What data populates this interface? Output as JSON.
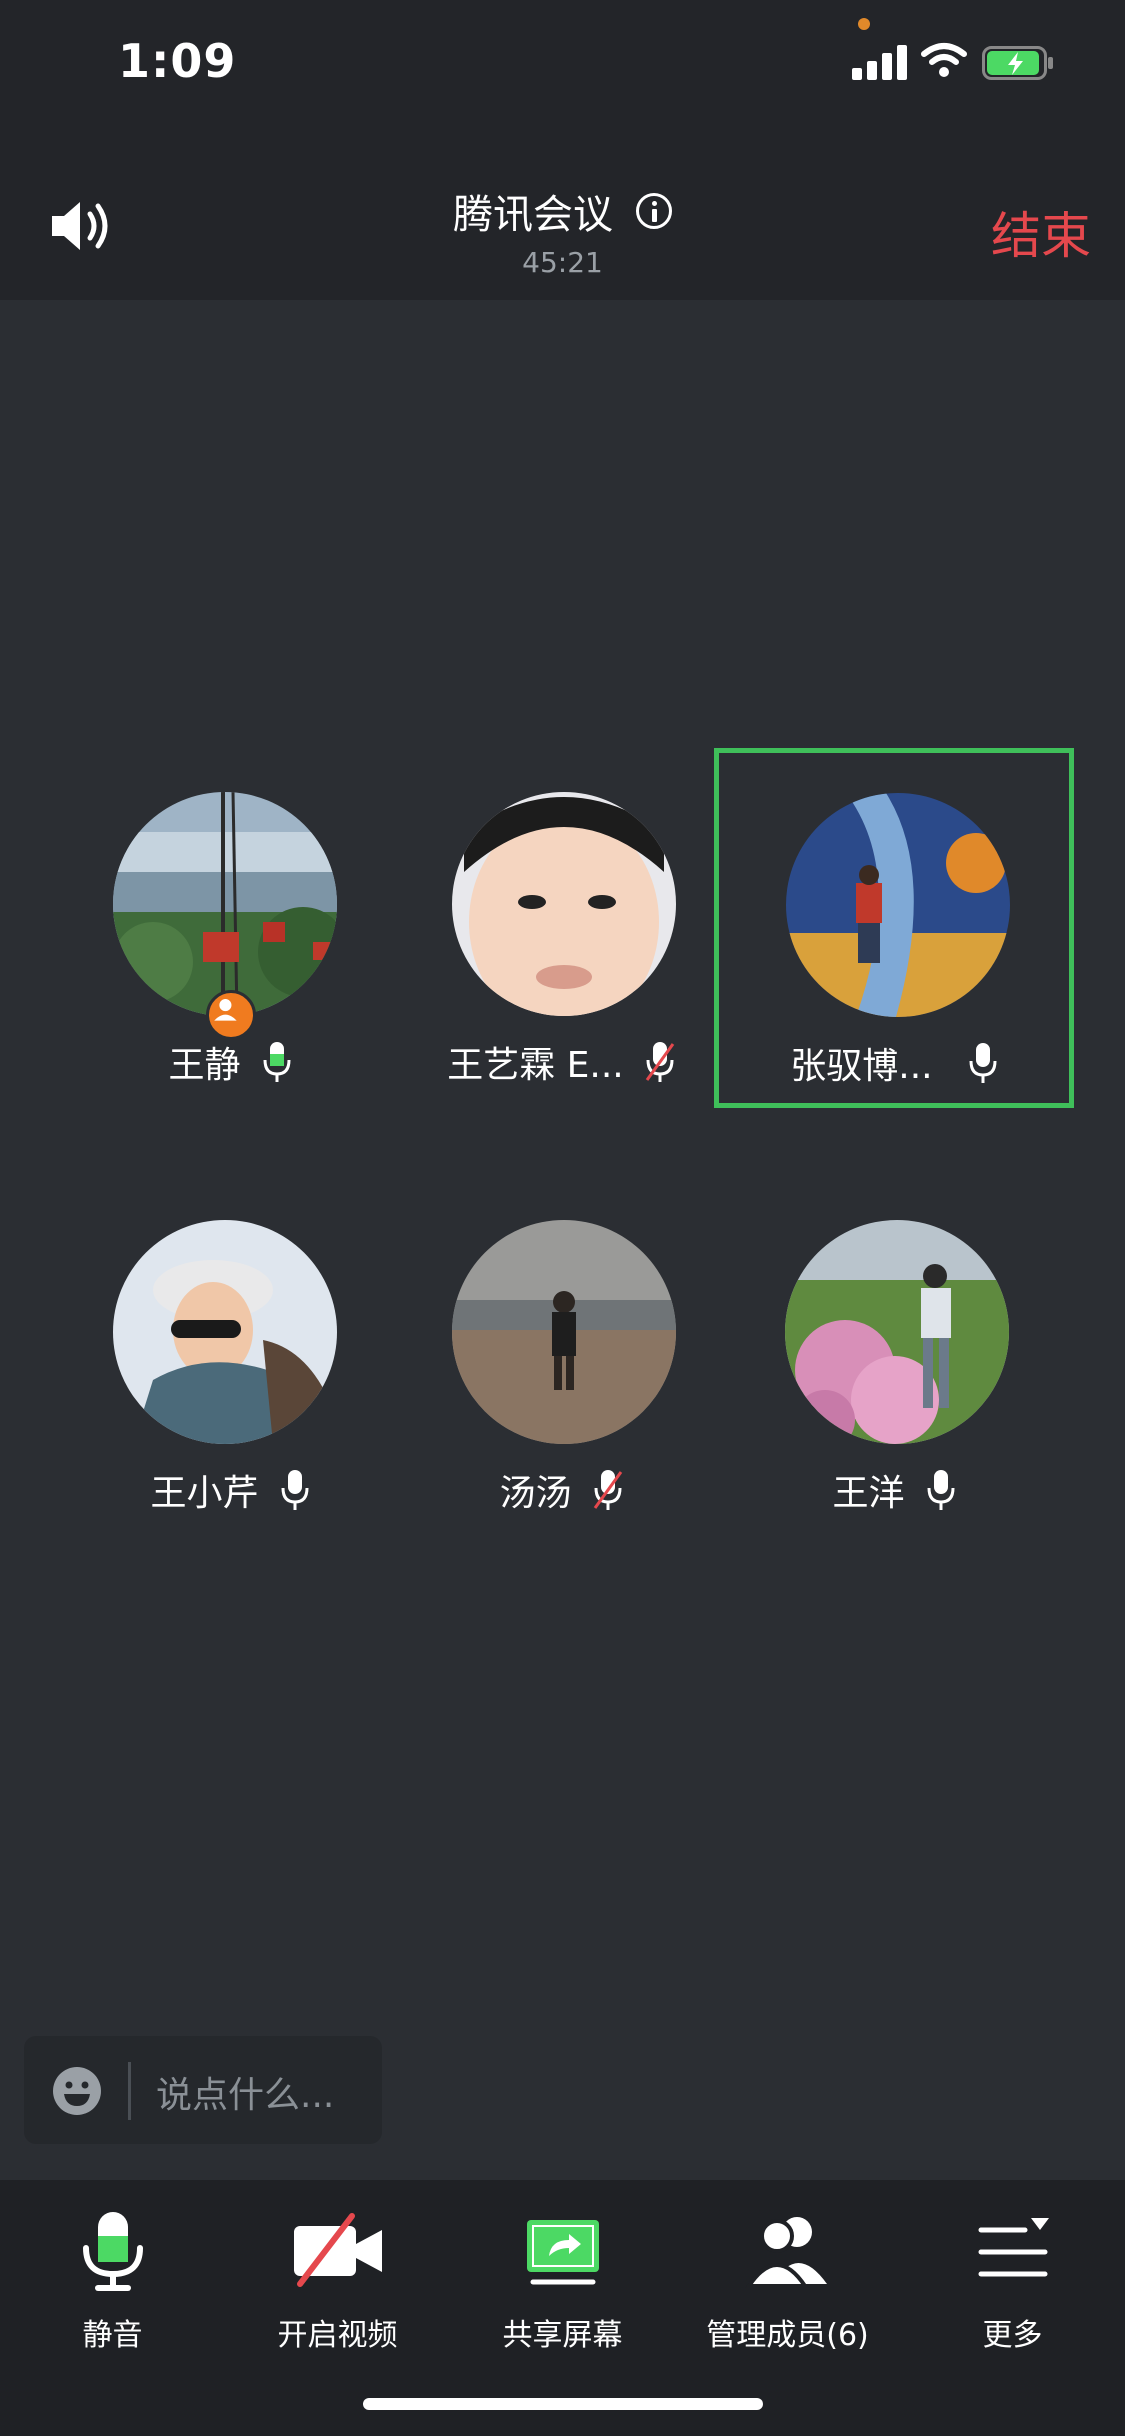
{
  "status_bar": {
    "time": "1:09"
  },
  "header": {
    "title": "腾讯会议",
    "duration": "45:21",
    "end_label": "结束"
  },
  "participants": [
    {
      "name": "王静",
      "mic": "on-active",
      "host": true
    },
    {
      "name": "王艺霖 E...",
      "mic": "muted",
      "host": false
    },
    {
      "name": "张驭博...",
      "mic": "on",
      "host": false,
      "speaking": true
    },
    {
      "name": "王小芹",
      "mic": "on",
      "host": false
    },
    {
      "name": "汤汤",
      "mic": "muted",
      "host": false
    },
    {
      "name": "王洋",
      "mic": "on",
      "host": false
    }
  ],
  "chat": {
    "placeholder": "说点什么..."
  },
  "toolbar": {
    "mute_label": "静音",
    "video_label": "开启视频",
    "share_label": "共享屏幕",
    "members_label": "管理成员(6)",
    "more_label": "更多"
  },
  "colors": {
    "background": "#2b2e33",
    "header": "#232529",
    "toolbar": "#1f2125",
    "end": "#e5484d",
    "active_border": "#3fbf5a",
    "mic_active": "#4cd964",
    "host_badge": "#f07b1f"
  },
  "icons": [
    "speaker-icon",
    "info-icon",
    "signal-icon",
    "wifi-icon",
    "battery-icon",
    "mic-icon",
    "mic-muted-icon",
    "host-icon",
    "emoji-icon",
    "video-off-icon",
    "share-screen-icon",
    "members-icon",
    "more-icon"
  ]
}
